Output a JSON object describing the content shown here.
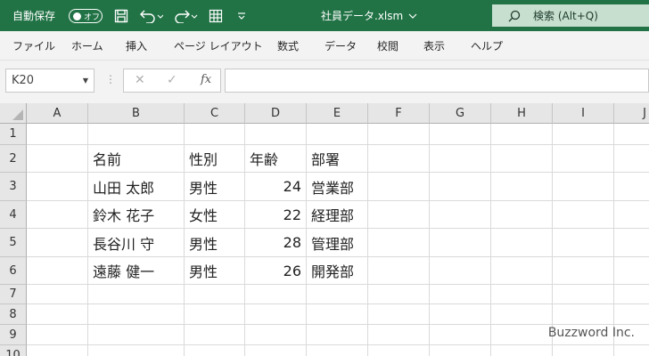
{
  "titlebar": {
    "autosave_label": "自動保存",
    "autosave_state": "オフ",
    "document_title": "社員データ.xlsm",
    "search_placeholder": "検索 (Alt+Q)",
    "accent_color": "#217346"
  },
  "quick_access": [
    "save-icon",
    "undo-icon",
    "redo-icon",
    "table-format-icon",
    "customize-icon"
  ],
  "ribbon": {
    "tabs": [
      "ファイル",
      "ホーム",
      "挿入",
      "ページ レイアウト",
      "数式",
      "データ",
      "校閲",
      "表示",
      "ヘルプ"
    ]
  },
  "formula_bar": {
    "name_box": "K20",
    "fx_label": "fx",
    "cancel_symbol": "✕",
    "enter_symbol": "✓",
    "formula": ""
  },
  "grid": {
    "columns": [
      "A",
      "B",
      "C",
      "D",
      "E",
      "F",
      "G",
      "H",
      "I",
      "J"
    ],
    "rows": [
      "1",
      "2",
      "3",
      "4",
      "5",
      "6",
      "7",
      "8",
      "9",
      "10"
    ],
    "table": {
      "headers": [
        "名前",
        "性別",
        "年齢",
        "部署"
      ],
      "records": [
        [
          "山田 太郎",
          "男性",
          "24",
          "営業部"
        ],
        [
          "鈴木 花子",
          "女性",
          "22",
          "経理部"
        ],
        [
          "長谷川 守",
          "男性",
          "28",
          "管理部"
        ],
        [
          "遠藤 健一",
          "男性",
          "26",
          "開発部"
        ]
      ]
    }
  },
  "watermark": "Buzzword Inc."
}
